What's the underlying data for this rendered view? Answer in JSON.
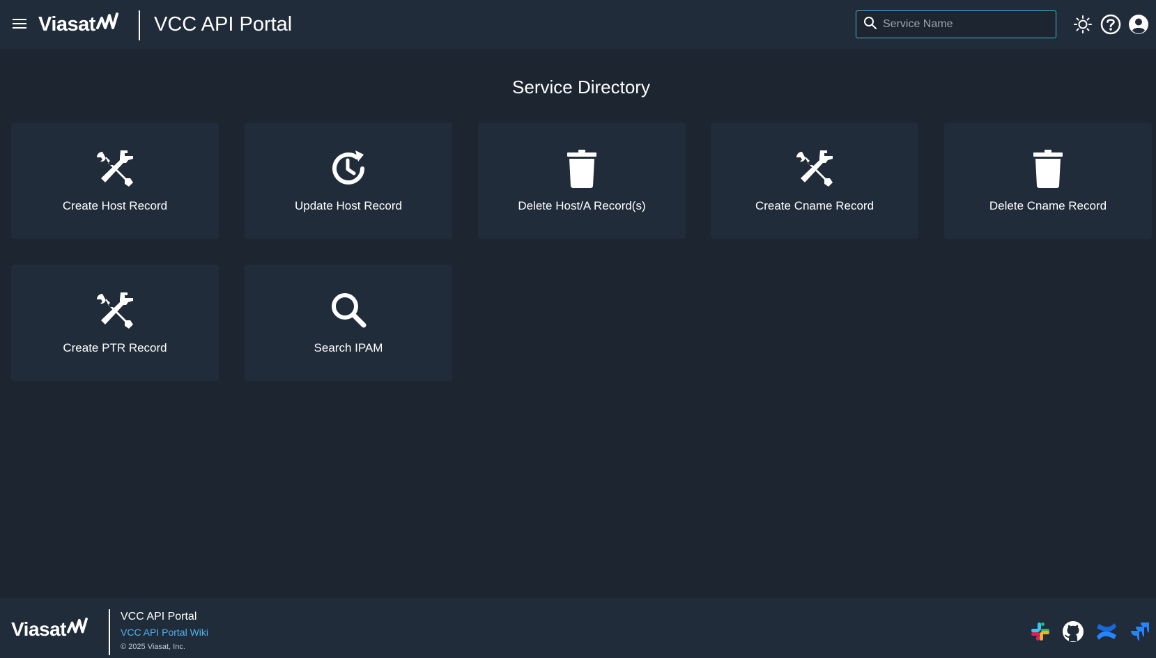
{
  "header": {
    "logo_text": "Viasat",
    "title": "VCC API Portal",
    "search": {
      "placeholder": "Service Name",
      "value": ""
    },
    "icons": [
      "menu-icon",
      "search-icon",
      "theme-toggle-icon",
      "help-icon",
      "account-icon"
    ]
  },
  "main": {
    "title": "Service Directory",
    "cards": [
      {
        "label": "Create Host Record",
        "icon": "tools-icon"
      },
      {
        "label": "Update Host Record",
        "icon": "update-clock-icon"
      },
      {
        "label": "Delete Host/A Record(s)",
        "icon": "trash-icon"
      },
      {
        "label": "Create Cname Record",
        "icon": "tools-icon"
      },
      {
        "label": "Delete Cname Record",
        "icon": "trash-icon"
      },
      {
        "label": "Create PTR Record",
        "icon": "tools-icon"
      },
      {
        "label": "Search IPAM",
        "icon": "search-icon"
      }
    ]
  },
  "footer": {
    "logo_text": "Viasat",
    "title": "VCC API Portal",
    "wiki_link": "VCC API Portal Wiki",
    "copyright": "© 2025 Viasat, Inc.",
    "icons": [
      "slack-icon",
      "github-icon",
      "confluence-icon",
      "jira-icon"
    ]
  },
  "colors": {
    "background": "#1c2530",
    "surface": "#202c39",
    "accent": "#4fb3d9",
    "link": "#4fb3f0"
  }
}
